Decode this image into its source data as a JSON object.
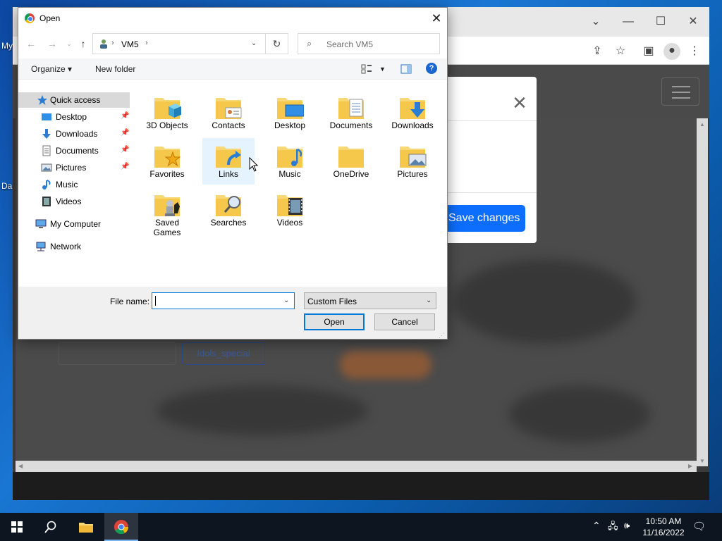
{
  "desktop": {
    "labels": [
      "My",
      "Da"
    ]
  },
  "browser": {
    "window_controls": {
      "chevron": "⌄",
      "minimize": "—",
      "maximize": "☐",
      "close": "✕"
    },
    "toolbar_icons": [
      "share-icon",
      "star-icon",
      "sidebar-icon",
      "profile-icon",
      "menu-icon"
    ]
  },
  "page_behind": {
    "modal": {
      "close_glyph": "✕",
      "save_label": "Save changes"
    },
    "ghost_button_label": "Idols_special"
  },
  "dialog": {
    "title": "Open",
    "close_glyph": "✕",
    "address": {
      "crumb": "VM5"
    },
    "search_placeholder": "Search VM5",
    "commands": {
      "organize": "Organize ▾",
      "new_folder": "New folder"
    },
    "help_glyph": "?",
    "nav_pane": [
      {
        "label": "Quick access",
        "icon": "star-icon",
        "pinned": false
      },
      {
        "label": "Desktop",
        "icon": "desktop-icon",
        "pinned": true
      },
      {
        "label": "Downloads",
        "icon": "download-icon",
        "pinned": true
      },
      {
        "label": "Documents",
        "icon": "document-icon",
        "pinned": true
      },
      {
        "label": "Pictures",
        "icon": "picture-icon",
        "pinned": true
      },
      {
        "label": "Music",
        "icon": "music-icon",
        "pinned": false
      },
      {
        "label": "Videos",
        "icon": "video-icon",
        "pinned": false
      },
      {
        "label": "My Computer",
        "icon": "computer-icon",
        "pinned": false
      },
      {
        "label": "Network",
        "icon": "network-icon",
        "pinned": false
      }
    ],
    "folders": [
      {
        "label": "3D Objects",
        "icon": "3d-objects-folder-icon"
      },
      {
        "label": "Contacts",
        "icon": "contacts-folder-icon"
      },
      {
        "label": "Desktop",
        "icon": "desktop-folder-icon"
      },
      {
        "label": "Documents",
        "icon": "documents-folder-icon"
      },
      {
        "label": "Downloads",
        "icon": "downloads-folder-icon"
      },
      {
        "label": "Favorites",
        "icon": "favorites-folder-icon"
      },
      {
        "label": "Links",
        "icon": "links-folder-icon"
      },
      {
        "label": "Music",
        "icon": "music-folder-icon"
      },
      {
        "label": "OneDrive",
        "icon": "onedrive-folder-icon"
      },
      {
        "label": "Pictures",
        "icon": "pictures-folder-icon"
      },
      {
        "label": "Saved Games",
        "icon": "saved-games-folder-icon"
      },
      {
        "label": "Searches",
        "icon": "searches-folder-icon"
      },
      {
        "label": "Videos",
        "icon": "videos-folder-icon"
      }
    ],
    "file_name_label": "File name:",
    "file_name_value": "",
    "filter_value": "Custom Files",
    "open_label": "Open",
    "cancel_label": "Cancel"
  },
  "taskbar": {
    "time": "10:50 AM",
    "date": "11/16/2022",
    "tray_icons": [
      "chevron-up-icon",
      "network-icon",
      "volume-icon",
      "notification-icon"
    ]
  },
  "colors": {
    "folder_yellow": "#f8d775",
    "folder_dark": "#e0a82e",
    "accent_blue": "#0078d7",
    "bootstrap_primary": "#0d6efd"
  }
}
